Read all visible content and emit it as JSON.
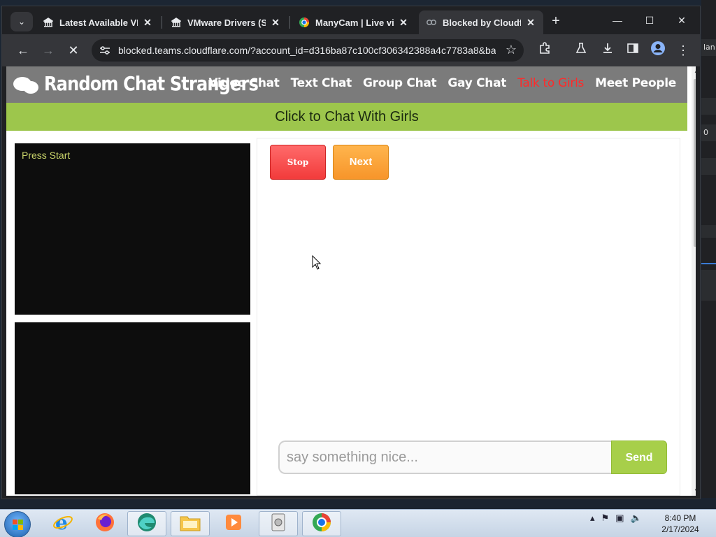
{
  "browser": {
    "tabs": [
      {
        "label": "Latest Available VMwa",
        "icon": "bank-icon"
      },
      {
        "label": "VMware Drivers (SVGA)",
        "icon": "bank-icon"
      },
      {
        "label": "ManyCam | Live video",
        "icon": "manycam-icon"
      },
      {
        "label": "Blocked by Cloudflare",
        "icon": "cloudflare-icon",
        "active": true
      }
    ],
    "url": "blocked.teams.cloudflare.com/?account_id=d316ba87c100cf306342388a4c7783a8&ba..."
  },
  "site": {
    "title": "Random Chat Strangers",
    "nav": [
      {
        "label": "Video Chat"
      },
      {
        "label": "Text Chat"
      },
      {
        "label": "Group Chat"
      },
      {
        "label": "Gay Chat"
      },
      {
        "label": "Talk to Girls",
        "highlight": true
      },
      {
        "label": "Meet People"
      }
    ],
    "promo_banner": "Click to Chat With Girls",
    "video_status": "Press Start",
    "stop_label": "Stop",
    "next_label": "Next",
    "message_placeholder": "say something nice...",
    "send_label": "Send"
  },
  "background_window": {
    "text_top": "lan",
    "text_mid": "0"
  },
  "taskbar": {
    "time": "8:40 PM",
    "date": "2/17/2024",
    "apps": [
      "internet-explorer-icon",
      "firefox-icon",
      "edge-icon",
      "file-explorer-icon",
      "media-player-icon",
      "disk-icon",
      "chrome-icon"
    ]
  },
  "colors": {
    "header_bg": "#7b7b7b",
    "promo_bg": "#9dc64c",
    "highlight_link": "#ff2a2a",
    "stop_button": "#f23b3b",
    "next_button": "#f7952a",
    "send_button": "#a7cf4a"
  }
}
